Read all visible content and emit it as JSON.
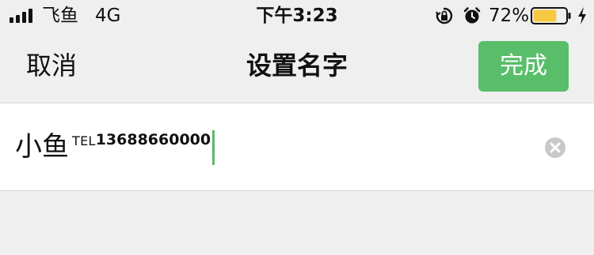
{
  "status_bar": {
    "carrier": "飞鱼",
    "network": "4G",
    "time": "下午3:23",
    "battery_percent": "72%",
    "battery_level": 0.72,
    "battery_color": "#f7c940",
    "icons": [
      "signal-icon",
      "orientation-lock-icon",
      "alarm-icon",
      "battery-icon",
      "charging-bolt-icon"
    ]
  },
  "nav": {
    "cancel_label": "取消",
    "title": "设置名字",
    "done_label": "完成",
    "done_color": "#58be6a"
  },
  "input": {
    "main_text": "小鱼",
    "tel_text": "TEL",
    "number_text": "13688660000",
    "cursor_color": "#5bb86a",
    "clear_icon": "clear-input-icon"
  }
}
